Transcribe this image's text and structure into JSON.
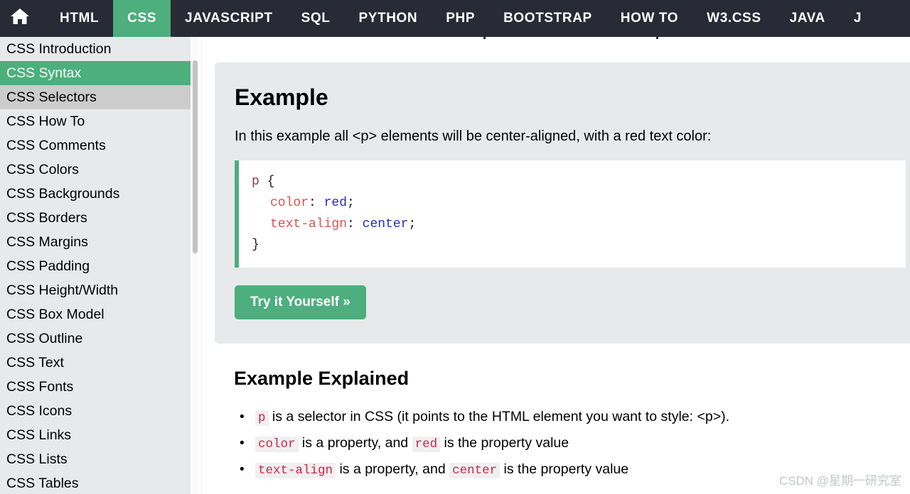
{
  "topnav": {
    "home_icon": "home-icon",
    "items": [
      {
        "label": "HTML",
        "active": false
      },
      {
        "label": "CSS",
        "active": true
      },
      {
        "label": "JAVASCRIPT",
        "active": false
      },
      {
        "label": "SQL",
        "active": false
      },
      {
        "label": "PYTHON",
        "active": false
      },
      {
        "label": "PHP",
        "active": false
      },
      {
        "label": "BOOTSTRAP",
        "active": false
      },
      {
        "label": "HOW TO",
        "active": false
      },
      {
        "label": "W3.CSS",
        "active": false
      },
      {
        "label": "JAVA",
        "active": false
      },
      {
        "label": "J",
        "active": false
      }
    ]
  },
  "sidebar": {
    "items": [
      {
        "label": "CSS Introduction",
        "state": "normal"
      },
      {
        "label": "CSS Syntax",
        "state": "active"
      },
      {
        "label": "CSS Selectors",
        "state": "hover"
      },
      {
        "label": "CSS How To",
        "state": "normal"
      },
      {
        "label": "CSS Comments",
        "state": "normal"
      },
      {
        "label": "CSS Colors",
        "state": "normal"
      },
      {
        "label": "CSS Backgrounds",
        "state": "normal"
      },
      {
        "label": "CSS Borders",
        "state": "normal"
      },
      {
        "label": "CSS Margins",
        "state": "normal"
      },
      {
        "label": "CSS Padding",
        "state": "normal"
      },
      {
        "label": "CSS Height/Width",
        "state": "normal"
      },
      {
        "label": "CSS Box Model",
        "state": "normal"
      },
      {
        "label": "CSS Outline",
        "state": "normal"
      },
      {
        "label": "CSS Text",
        "state": "normal"
      },
      {
        "label": "CSS Fonts",
        "state": "normal"
      },
      {
        "label": "CSS Icons",
        "state": "normal"
      },
      {
        "label": "CSS Links",
        "state": "normal"
      },
      {
        "label": "CSS Lists",
        "state": "normal"
      },
      {
        "label": "CSS Tables",
        "state": "normal"
      }
    ]
  },
  "example": {
    "title": "Example",
    "description": "In this example all <p> elements will be center-aligned, with a red text color:",
    "code": {
      "selector": "p",
      "open_brace": " {",
      "line1_prop": "color",
      "line1_colon": ": ",
      "line1_val": "red",
      "line1_semi": ";",
      "line2_prop": "text-align",
      "line2_colon": ": ",
      "line2_val": "center",
      "line2_semi": ";",
      "close_brace": "}"
    },
    "tryit_label": "Try it Yourself »"
  },
  "explained": {
    "title": "Example Explained",
    "bullets": [
      {
        "code1": "p",
        "text1": " is a selector in CSS (it points to the HTML element you want to style: <p>).",
        "code2": "",
        "text2": ""
      },
      {
        "code1": "color",
        "text1": " is a property, and ",
        "code2": "red",
        "text2": " is the property value"
      },
      {
        "code1": "text-align",
        "text1": " is a property, and ",
        "code2": "center",
        "text2": " is the property value"
      }
    ]
  },
  "watermark": {
    "text": "CSDN @星期一研究室"
  },
  "colors": {
    "nav_bg": "#282a35",
    "accent_green": "#4CAF7D",
    "sidebar_bg": "#e7e9eb",
    "sidebar_hover": "#cccccc",
    "example_box_bg": "#e7e9eb",
    "code_selector": "#8b3a4b",
    "code_property": "#d9534f",
    "code_value": "#2b2bbf",
    "inline_code_text": "#c7254e",
    "inline_code_bg": "#f1eff0",
    "watermark": "#c3c6c9"
  }
}
